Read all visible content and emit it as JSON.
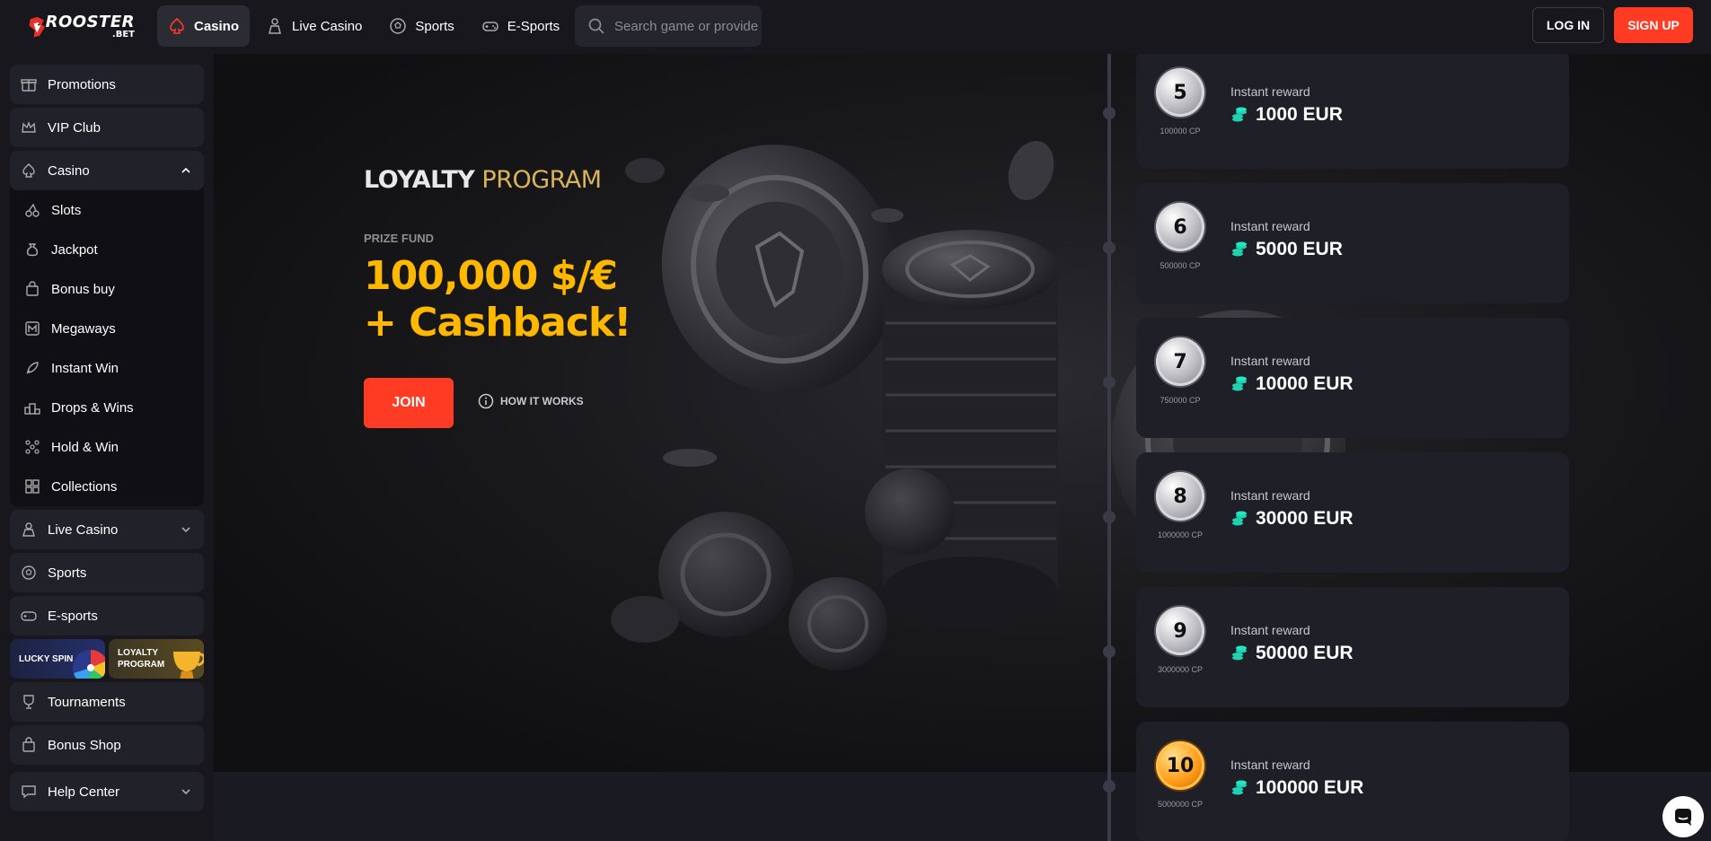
{
  "brand": {
    "word": "ROOSTER",
    "sub": ".BET"
  },
  "nav": [
    {
      "label": "Casino",
      "icon": "spade-icon",
      "active": true
    },
    {
      "label": "Live Casino",
      "icon": "dealer-icon"
    },
    {
      "label": "Sports",
      "icon": "soccer-ball-icon"
    },
    {
      "label": "E-Sports",
      "icon": "gamepad-icon"
    }
  ],
  "search": {
    "placeholder": "Search game or provider"
  },
  "auth": {
    "login": "LOG IN",
    "signup": "SIGN UP"
  },
  "sidebar": {
    "promotions": "Promotions",
    "vip": "VIP Club",
    "casino": "Casino",
    "casino_items": [
      "Slots",
      "Jackpot",
      "Bonus buy",
      "Megaways",
      "Instant Win",
      "Drops & Wins",
      "Hold & Win",
      "Collections"
    ],
    "live_casino": "Live Casino",
    "sports": "Sports",
    "esports": "E-sports",
    "lucky_spin": "LUCKY SPIN",
    "loyalty_line1": "LOYALTY",
    "loyalty_line2": "PROGRAM",
    "tournaments": "Tournaments",
    "bonus_shop": "Bonus Shop",
    "help_center": "Help Center"
  },
  "hero": {
    "title_word1": "LOYALTY",
    "title_word2": "PROGRAM",
    "prize_label": "PRIZE FUND",
    "prize_line1": "100,000 $/€",
    "prize_line2": "+ Cashback!",
    "join": "JOIN",
    "how": "HOW IT WORKS"
  },
  "levels": [
    {
      "level": "5",
      "cp": "100000 CP",
      "reward_label": "Instant reward",
      "reward": "1000 EUR",
      "tier": "silver"
    },
    {
      "level": "6",
      "cp": "500000 CP",
      "reward_label": "Instant reward",
      "reward": "5000 EUR",
      "tier": "silver"
    },
    {
      "level": "7",
      "cp": "750000 CP",
      "reward_label": "Instant reward",
      "reward": "10000 EUR",
      "tier": "silver"
    },
    {
      "level": "8",
      "cp": "1000000 CP",
      "reward_label": "Instant reward",
      "reward": "30000 EUR",
      "tier": "silver"
    },
    {
      "level": "9",
      "cp": "3000000 CP",
      "reward_label": "Instant reward",
      "reward": "50000 EUR",
      "tier": "silver"
    },
    {
      "level": "10",
      "cp": "5000000 CP",
      "reward_label": "Instant reward",
      "reward": "100000 EUR",
      "tier": "gold"
    }
  ],
  "colors": {
    "accent": "#ff3b24",
    "prize": "#ffb800",
    "coin": "#1ed1b0"
  }
}
